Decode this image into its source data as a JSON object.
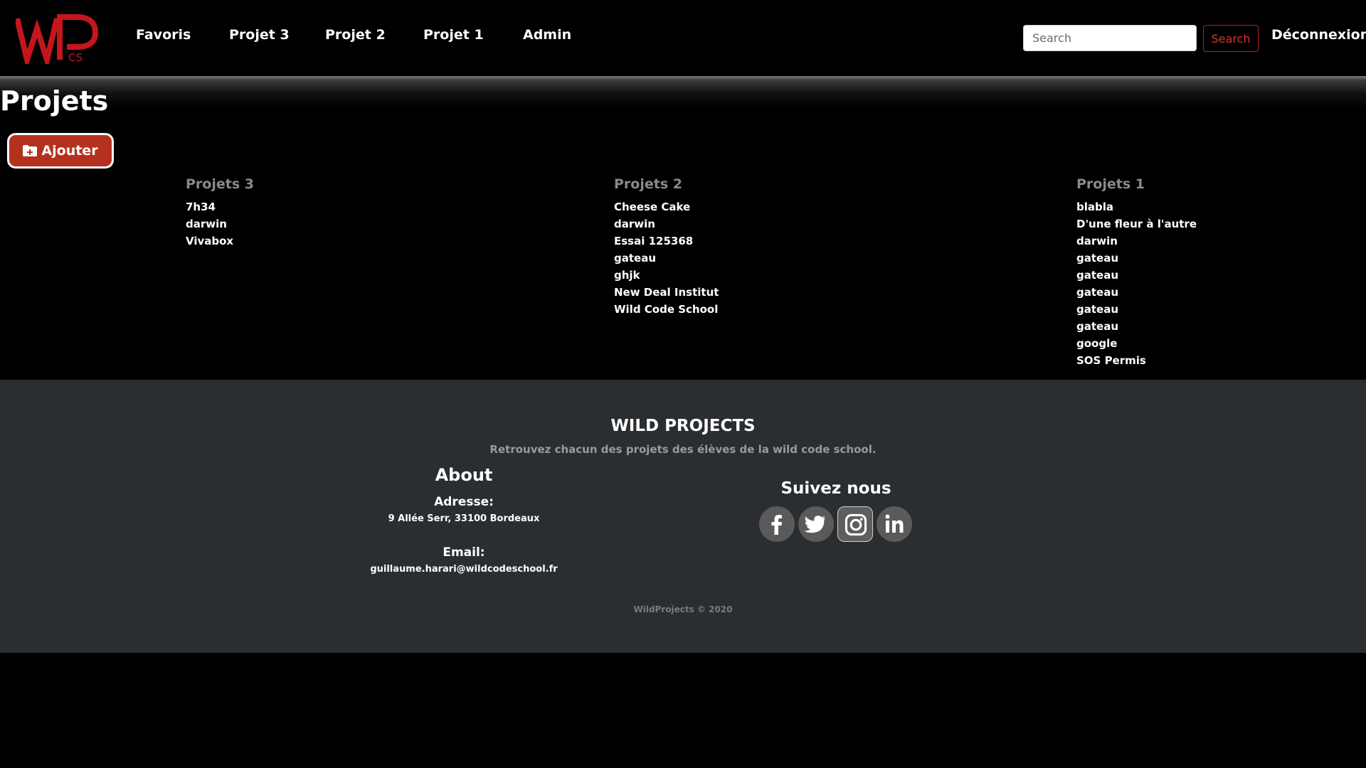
{
  "logo": {
    "text": "WP",
    "subtext": "CS",
    "color": "#c4161c"
  },
  "nav": {
    "links": [
      "Favoris",
      "Projet 3",
      "Projet 2",
      "Projet 1",
      "Admin"
    ],
    "search_placeholder": "Search",
    "search_button": "Search",
    "logout": "Déconnexion"
  },
  "main": {
    "title": "Projets",
    "add_button": "Ajouter",
    "columns": [
      {
        "heading": "Projets 3",
        "items": [
          "7h34",
          "darwin",
          "Vivabox"
        ]
      },
      {
        "heading": "Projets 2",
        "items": [
          "Cheese Cake",
          "darwin",
          "Essai 125368",
          "gateau",
          "ghjk",
          "New Deal Institut",
          "Wild Code School"
        ]
      },
      {
        "heading": "Projets 1",
        "items": [
          "blabla",
          "D'une fleur à l'autre",
          "darwin",
          "gateau",
          "gateau",
          "gateau",
          "gateau",
          "gateau",
          "google",
          "SOS Permis"
        ]
      }
    ]
  },
  "footer": {
    "title": "WILD PROJECTS",
    "tagline": "Retrouvez chacun des projets des élèves de la wild code school.",
    "about_title": "About",
    "address_label": "Adresse:",
    "address": "9 Allée Serr, 33100 Bordeaux",
    "email_label": "Email:",
    "email": "guillaume.harari@wildcodeschool.fr",
    "follow_title": "Suivez nous",
    "socials": [
      "facebook-icon",
      "twitter-icon",
      "instagram-icon",
      "linkedin-icon"
    ],
    "copyright": "WildProjects © 2020"
  },
  "colors": {
    "accent_red": "#c4161c",
    "button_red": "#b5311f",
    "footer_bg": "#2b2e31"
  }
}
